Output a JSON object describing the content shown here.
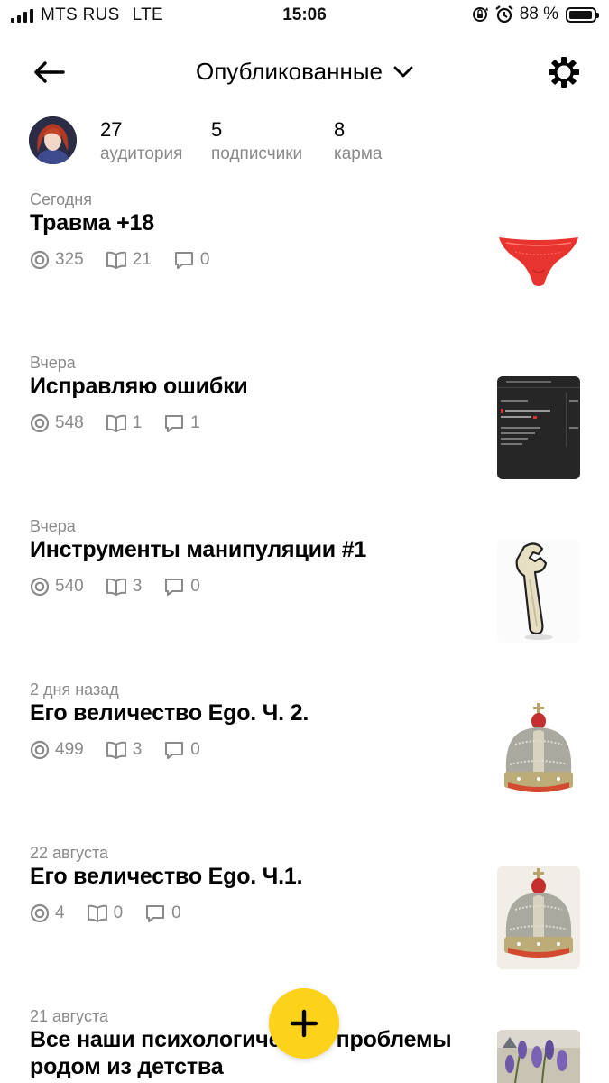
{
  "status_bar": {
    "carrier": "MTS RUS",
    "network": "LTE",
    "time": "15:06",
    "battery_percent": "88 %"
  },
  "header": {
    "title": "Опубликованные"
  },
  "profile": {
    "stats": [
      {
        "value": "27",
        "label": "аудитория"
      },
      {
        "value": "5",
        "label": "подписчики"
      },
      {
        "value": "8",
        "label": "карма"
      }
    ]
  },
  "articles": [
    {
      "date": "Сегодня",
      "title": "Травма +18",
      "views": "325",
      "reads": "21",
      "comments": "0",
      "thumb": "red-lingerie-image"
    },
    {
      "date": "Вчера",
      "title": "Исправляю ошибки",
      "views": "548",
      "reads": "1",
      "comments": "1",
      "thumb": "dark-table-screenshot"
    },
    {
      "date": "Вчера",
      "title": "Инструменты манипуляции #1",
      "views": "540",
      "reads": "3",
      "comments": "0",
      "thumb": "wrench-image"
    },
    {
      "date": "2 дня назад",
      "title": "Его величество Ego. Ч. 2.",
      "views": "499",
      "reads": "3",
      "comments": "0",
      "thumb": "crown-image"
    },
    {
      "date": "22 августа",
      "title": "Его величество Ego. Ч.1.",
      "views": "4",
      "reads": "0",
      "comments": "0",
      "thumb": "crown-image"
    },
    {
      "date": "21 августа",
      "title": "Все наши психологические проблемы",
      "title_line2": "родом из детства",
      "thumb": "lavender-image"
    }
  ],
  "colors": {
    "accent_yellow": "#fcd21b",
    "muted_text": "#8a8a8a"
  }
}
